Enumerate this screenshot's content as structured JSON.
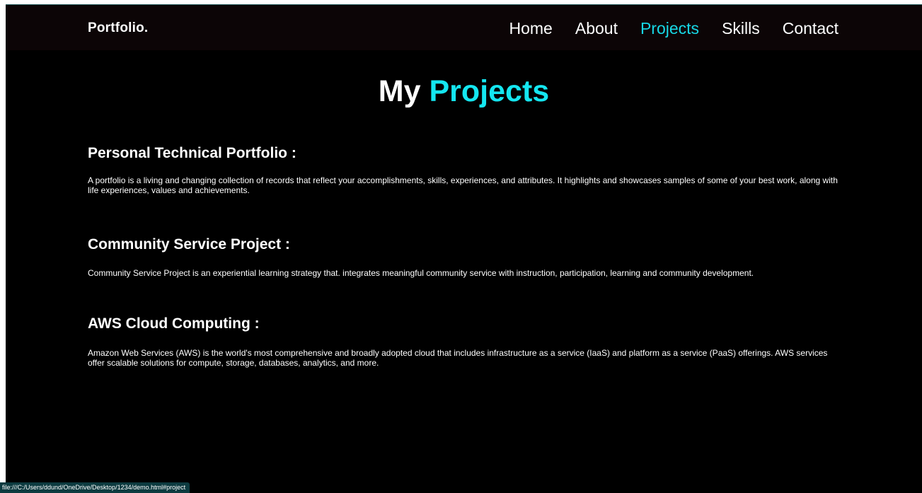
{
  "navbar": {
    "brand": "Portfolio.",
    "links": [
      {
        "label": "Home",
        "active": false
      },
      {
        "label": "About",
        "active": false
      },
      {
        "label": "Projects",
        "active": true
      },
      {
        "label": "Skills",
        "active": false
      },
      {
        "label": "Contact",
        "active": false
      }
    ]
  },
  "title": {
    "prefix": "My",
    "accent": "Projects"
  },
  "projects": [
    {
      "heading": "Personal Technical Portfolio :",
      "description": "A portfolio is a living and changing collection of records that reflect your accomplishments, skills, experiences, and attributes. It highlights and showcases samples of some of your best work, along with life experiences, values and achievements."
    },
    {
      "heading": "Community Service Project :",
      "description": "Community Service Project is an experiential learning strategy that. integrates meaningful community service with instruction, participation, learning and community development."
    },
    {
      "heading": "AWS Cloud Computing :",
      "description": "Amazon Web Services (AWS) is the world's most comprehensive and broadly adopted cloud that includes infrastructure as a service (IaaS) and platform as a service (PaaS) offerings. AWS services offer scalable solutions for compute, storage, databases, analytics, and more."
    }
  ],
  "status_bar": {
    "url": "file:///C:/Users/ddund/OneDrive/Desktop/1234/demo.html#project"
  },
  "colors": {
    "accent": "#14e6f0",
    "background": "#000000",
    "navbar_background": "#0c0506",
    "status_bar_background": "#0d3b40"
  }
}
